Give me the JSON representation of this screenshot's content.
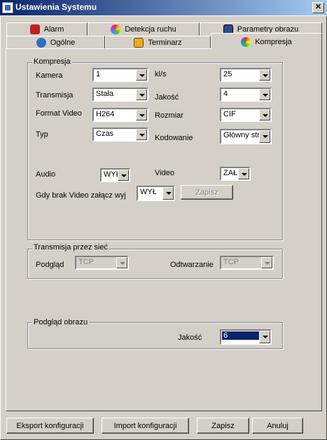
{
  "window": {
    "title": "Ustawienia Systemu",
    "close_glyph": "✕",
    "icon": "app-icon"
  },
  "tabs": {
    "alarm": {
      "label": "Alarm",
      "icon": "alarm-icon"
    },
    "detekcja": {
      "label": "Detekcja ruchu",
      "icon": "motion-icon"
    },
    "parametry": {
      "label": "Parametry obrazu",
      "icon": "image-params-icon"
    },
    "ogolne": {
      "label": "Ogólne",
      "icon": "general-icon"
    },
    "terminarz": {
      "label": "Terminarz",
      "icon": "schedule-icon"
    },
    "kompresja": {
      "label": "Kompresja",
      "icon": "compression-icon",
      "active": true
    }
  },
  "kompresja_group": {
    "legend": "Kompresja",
    "kamera": {
      "label": "Kamera",
      "value": "1"
    },
    "transmisja": {
      "label": "Transmisja",
      "value": "Stała"
    },
    "format": {
      "label": "Format Video",
      "value": "H264"
    },
    "typ": {
      "label": "Typ",
      "value": "Czas"
    },
    "fps": {
      "label": "kl/s",
      "value": "25"
    },
    "jakosc": {
      "label": "Jakość",
      "value": "4"
    },
    "rozmiar": {
      "label": "Rozmiar",
      "value": "CIF"
    },
    "kodowanie": {
      "label": "Kodowanie",
      "value": "Główny str"
    },
    "audio": {
      "label": "Audio",
      "value": "WYŁ"
    },
    "video": {
      "label": "Video",
      "value": "ZAŁ"
    },
    "brak_video": {
      "label": "Gdy brak Video załącz wyj",
      "value": "WYŁ"
    },
    "zapisz_label": "Zapisz"
  },
  "network_group": {
    "legend": "Transmisja przez sieć",
    "podglad": {
      "label": "Podgląd",
      "value": "TCP"
    },
    "odtwarzanie": {
      "label": "Odtwarzanie",
      "value": "TCP"
    }
  },
  "preview_group": {
    "legend": "Podgląd obrazu",
    "jakosc": {
      "label": "Jakość",
      "value": "6"
    }
  },
  "footer": {
    "export_label": "Eksport konfiguracji",
    "import_label": "Import konfiguracji",
    "save_label": "Zapisz",
    "cancel_label": "Anuluj"
  }
}
